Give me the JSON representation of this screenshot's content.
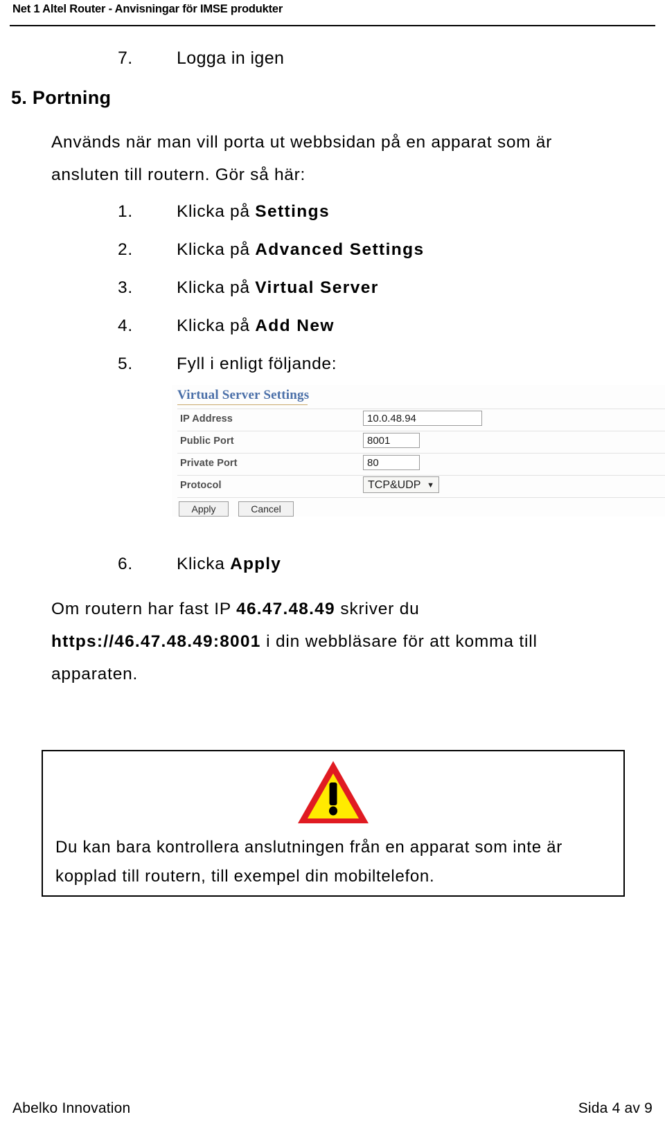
{
  "header": {
    "title": "Net 1 Altel Router - Anvisningar för IMSE produkter"
  },
  "carry_step": {
    "number": "7.",
    "text": "Logga in igen"
  },
  "section": {
    "heading": "5. Portning",
    "intro": "Används när man vill porta ut webbsidan på en apparat som är ansluten till routern. Gör så här:"
  },
  "steps": [
    {
      "number": "1.",
      "prefix": "Klicka på ",
      "bold": "Settings",
      "suffix": ""
    },
    {
      "number": "2.",
      "prefix": "Klicka på ",
      "bold": "Advanced Settings",
      "suffix": ""
    },
    {
      "number": "3.",
      "prefix": "Klicka på ",
      "bold": "Virtual Server",
      "suffix": ""
    },
    {
      "number": "4.",
      "prefix": "Klicka på ",
      "bold": "Add New",
      "suffix": ""
    },
    {
      "number": "5.",
      "prefix": "Fyll i enligt följande:",
      "bold": "",
      "suffix": ""
    }
  ],
  "router_screenshot": {
    "panel_title": "Virtual Server Settings",
    "rows": [
      {
        "label": "IP Address",
        "value": "10.0.48.94",
        "control": "text"
      },
      {
        "label": "Public Port",
        "value": "8001",
        "control": "text"
      },
      {
        "label": "Private Port",
        "value": "80",
        "control": "text"
      },
      {
        "label": "Protocol",
        "value": "TCP&UDP",
        "control": "select"
      }
    ],
    "buttons": [
      {
        "label": "Apply"
      },
      {
        "label": "Cancel"
      }
    ],
    "caret_glyph": "▼",
    "title_color": "#4a6fa8"
  },
  "step6": {
    "number": "6.",
    "prefix": "Klicka ",
    "bold": "Apply"
  },
  "note": {
    "line1_pre": "Om routern har fast IP ",
    "line1_bold": "46.47.48.49",
    "line1_post": " skriver du",
    "line2_bold": "https://46.47.48.49:8001",
    "line2_post": " i din webbläsare för att komma till",
    "line3": "apparaten."
  },
  "warning": {
    "icon_name": "warning-triangle-icon",
    "text": "Du kan bara kontrollera anslutningen från en apparat som inte är kopplad till routern, till exempel din mobiltelefon.",
    "colors": {
      "border": "#e01b22",
      "fill": "#ffeb00",
      "mark": "#000000"
    }
  },
  "footer": {
    "left": "Abelko Innovation",
    "right": "Sida 4 av 9"
  }
}
